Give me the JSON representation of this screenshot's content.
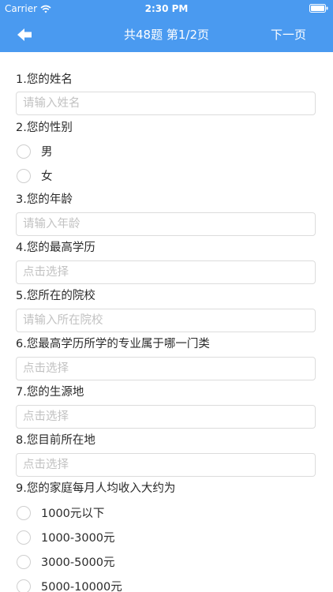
{
  "status_bar": {
    "carrier": "Carrier",
    "time": "2:30 PM"
  },
  "nav": {
    "title": "共48题 第1/2页",
    "next_label": "下一页"
  },
  "questions": [
    {
      "label": "1.您的姓名",
      "type": "text",
      "placeholder": "请输入姓名"
    },
    {
      "label": "2.您的性别",
      "type": "radio",
      "options": [
        "男",
        "女"
      ]
    },
    {
      "label": "3.您的年龄",
      "type": "text",
      "placeholder": "请输入年龄"
    },
    {
      "label": "4.您的最高学历",
      "type": "select",
      "placeholder": "点击选择"
    },
    {
      "label": "5.您所在的院校",
      "type": "text",
      "placeholder": "请输入所在院校"
    },
    {
      "label": "6.您最高学历所学的专业属于哪一门类",
      "type": "select",
      "placeholder": "点击选择"
    },
    {
      "label": "7.您的生源地",
      "type": "select",
      "placeholder": "点击选择"
    },
    {
      "label": "8.您目前所在地",
      "type": "select",
      "placeholder": "点击选择"
    },
    {
      "label": "9.您的家庭每月人均收入大约为",
      "type": "radio",
      "options": [
        "1000元以下",
        "1000-3000元",
        "3000-5000元",
        "5000-10000元"
      ]
    }
  ],
  "colors": {
    "header": "#4a9af0",
    "header_text": "#ffffff",
    "field_border": "#dcdcdc",
    "placeholder": "#c2c2c2"
  }
}
